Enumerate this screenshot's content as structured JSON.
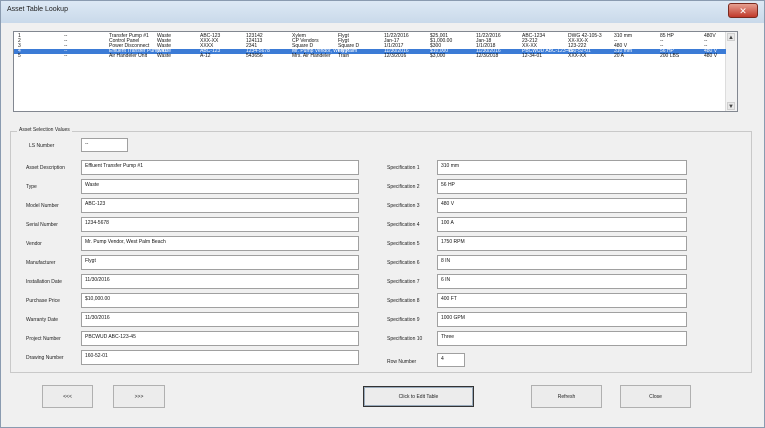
{
  "window": {
    "title": "Asset Table Lookup",
    "close_glyph": "✕"
  },
  "list": {
    "rows": [
      {
        "selected": false,
        "cells": [
          "1",
          "--",
          "Transfer Pump #1",
          "Waste",
          "ABC-123",
          "123142",
          "Xylem",
          "Flygt",
          "11/22/2016",
          "$25,001",
          "11/22/2016",
          "ABC-1234",
          "DWG 42-105-3",
          "310 mm",
          "85 HP",
          "480V"
        ]
      },
      {
        "selected": false,
        "cells": [
          "2",
          "--",
          "Control Panel",
          "Waste",
          "XXX-XX",
          "124113",
          "CP Vendors",
          "Flygt",
          "Jan-17",
          "$1,000.00",
          "Jan-18",
          "23-212",
          "XX-XX-X",
          "--",
          "--",
          "--"
        ]
      },
      {
        "selected": false,
        "cells": [
          "3",
          "--",
          "Power Disconnect",
          "Waste",
          "XXXX",
          "2341",
          "Square D",
          "Square D",
          "1/1/2017",
          "$300",
          "1/1/2018",
          "XX-XX",
          "123-222",
          "480 V",
          "--",
          "--"
        ]
      },
      {
        "selected": true,
        "cells": [
          "4",
          "--",
          "Effluent Transfer Pump #1",
          "Waste",
          "ABC-123",
          "1234-5678",
          "Mr. Pump Vendor, West Palm",
          "Flygt",
          "11/30/2016",
          "$10,000",
          "11/30/2016",
          "PBCWUD ABC-123-45",
          "160-52-01",
          "310 mm",
          "56 HP",
          "480 V"
        ]
      },
      {
        "selected": false,
        "cells": [
          "5",
          "--",
          "Air Handeler Unit",
          "Waste",
          "A-12",
          "543656",
          "Mrs. Air Handeler",
          "Train",
          "12/3/2016",
          "$3,000",
          "12/3/2018",
          "12-34-01",
          "XXX-XX",
          "20 A",
          "200 LBS",
          "480 V"
        ]
      }
    ]
  },
  "group": {
    "label": "Asset Selection Values"
  },
  "fields": {
    "ls_number": {
      "label": "LS Number",
      "value": "--"
    },
    "left": [
      {
        "label": "Asset Description",
        "value": "Effluent Transfer Pump #1"
      },
      {
        "label": "Type",
        "value": "Waste"
      },
      {
        "label": "Model Number",
        "value": "ABC-123"
      },
      {
        "label": "Serial Number",
        "value": "1234-5678"
      },
      {
        "label": "Vendor",
        "value": "Mr. Pump Vendor, West Palm Beach"
      },
      {
        "label": "Manufacturer",
        "value": "Flygt"
      },
      {
        "label": "Installation Date",
        "value": "11/30/2016"
      },
      {
        "label": "Purchase Price",
        "value": "$10,000.00"
      },
      {
        "label": "Warranty Date",
        "value": "11/30/2016"
      },
      {
        "label": "Project Number",
        "value": "PBCWUD ABC-123-45"
      },
      {
        "label": "Drawing Number",
        "value": "160-52-01"
      }
    ],
    "right": [
      {
        "label": "Specification 1",
        "value": "310 mm"
      },
      {
        "label": "Specification 2",
        "value": "56 HP"
      },
      {
        "label": "Specification 3",
        "value": "480 V"
      },
      {
        "label": "Specification 4",
        "value": "100 A"
      },
      {
        "label": "Specification 5",
        "value": "1750 RPM"
      },
      {
        "label": "Specification 6",
        "value": "8 IN"
      },
      {
        "label": "Specification 7",
        "value": "6 IN"
      },
      {
        "label": "Specification 8",
        "value": "400 FT"
      },
      {
        "label": "Specification 9",
        "value": "1000 GPM"
      },
      {
        "label": "Specification 10",
        "value": "Three"
      }
    ],
    "row_number": {
      "label": "Row Number",
      "value": "4"
    }
  },
  "buttons": {
    "prev": "<<<",
    "next": ">>>",
    "edit": "Click to Edit Table",
    "refresh": "Refresh",
    "close": "Close"
  }
}
